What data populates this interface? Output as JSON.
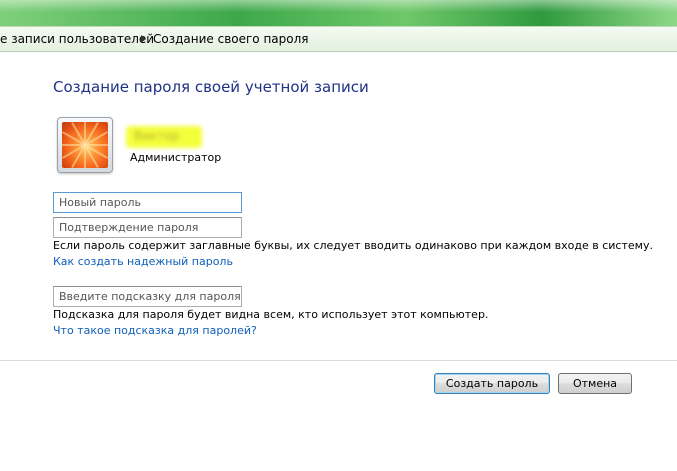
{
  "breadcrumb": {
    "parent": "е записи пользователей",
    "current": "Создание своего пароля"
  },
  "page": {
    "heading": "Создание пароля своей учетной записи"
  },
  "account": {
    "name": "Виктор",
    "role": "Администратор"
  },
  "form": {
    "new_password_placeholder": "Новый пароль",
    "confirm_password_placeholder": "Подтверждение пароля",
    "case_note": "Если пароль содержит заглавные буквы, их следует вводить одинаково при каждом входе в систему.",
    "strong_password_link": "Как создать надежный пароль",
    "hint_placeholder": "Введите подсказку для пароля",
    "hint_note": "Подсказка для пароля будет видна всем, кто использует этот компьютер.",
    "hint_link": "Что такое подсказка для паролей?"
  },
  "buttons": {
    "create": "Создать пароль",
    "cancel": "Отмена"
  },
  "colors": {
    "heading": "#1e3287",
    "link": "#0e5fb8",
    "highlight": "#f4ff3c"
  }
}
